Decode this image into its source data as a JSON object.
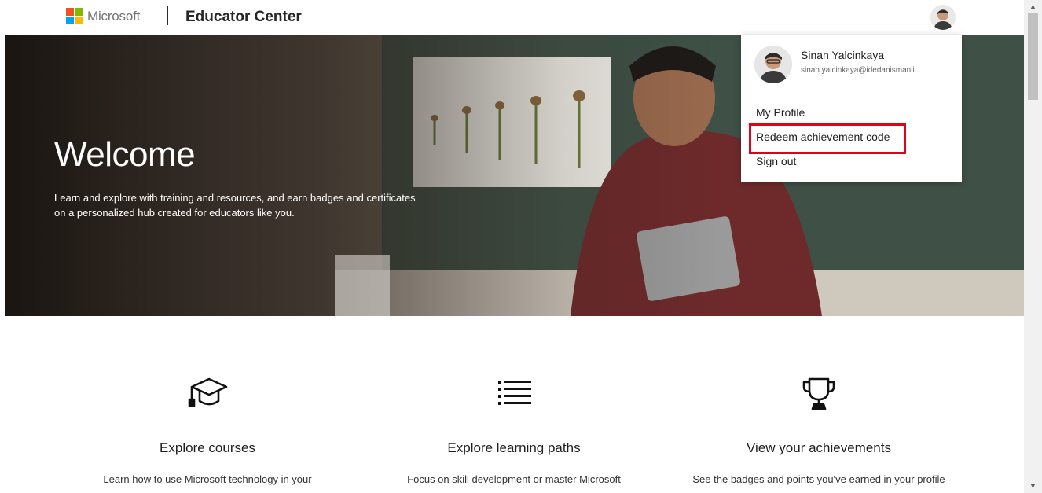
{
  "header": {
    "brand_logo": "Microsoft",
    "title": "Educator Center",
    "logo_colors": [
      "#f25022",
      "#7fba00",
      "#00a4ef",
      "#ffb900"
    ]
  },
  "hero": {
    "title": "Welcome",
    "subtitle": "Learn and explore with training and resources, and earn badges and certificates on a personalized hub created for educators like you."
  },
  "cards": [
    {
      "icon": "graduation-cap-icon",
      "title": "Explore courses",
      "text": "Learn how to use Microsoft technology in your"
    },
    {
      "icon": "list-icon",
      "title": "Explore learning paths",
      "text": "Focus on skill development or master Microsoft"
    },
    {
      "icon": "trophy-icon",
      "title": "View your achievements",
      "text": "See the badges and points you've earned in your profile"
    }
  ],
  "profile_menu": {
    "name": "Sinan Yalcinkaya",
    "email": "sinan.yalcinkaya@idedanismanli...",
    "items": [
      "My Profile",
      "Redeem achievement code",
      "Sign out"
    ],
    "highlight_color": "#e3001b"
  }
}
